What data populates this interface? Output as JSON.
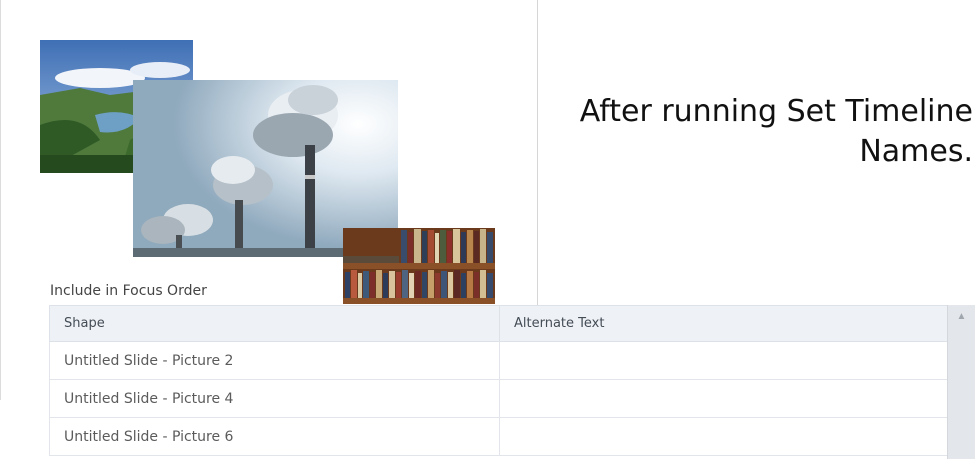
{
  "slide": {
    "headline": "After running Set Timeline Names.",
    "focus_label": "Include in Focus Order"
  },
  "table": {
    "columns": [
      "Shape",
      "Alternate Text"
    ],
    "rows": [
      [
        "Untitled Slide - Picture 2",
        ""
      ],
      [
        "Untitled Slide - Picture 4",
        ""
      ],
      [
        "Untitled Slide - Picture 6",
        ""
      ]
    ]
  },
  "scrollbar": {
    "up_arrow_icon": "triangle-up-icon"
  },
  "images": [
    {
      "name": "landscape-picture",
      "depicts": "mountains and lake"
    },
    {
      "name": "smokestack-picture",
      "depicts": "chimneys with smoke"
    },
    {
      "name": "bookshelf-picture",
      "depicts": "bookshelf"
    }
  ]
}
